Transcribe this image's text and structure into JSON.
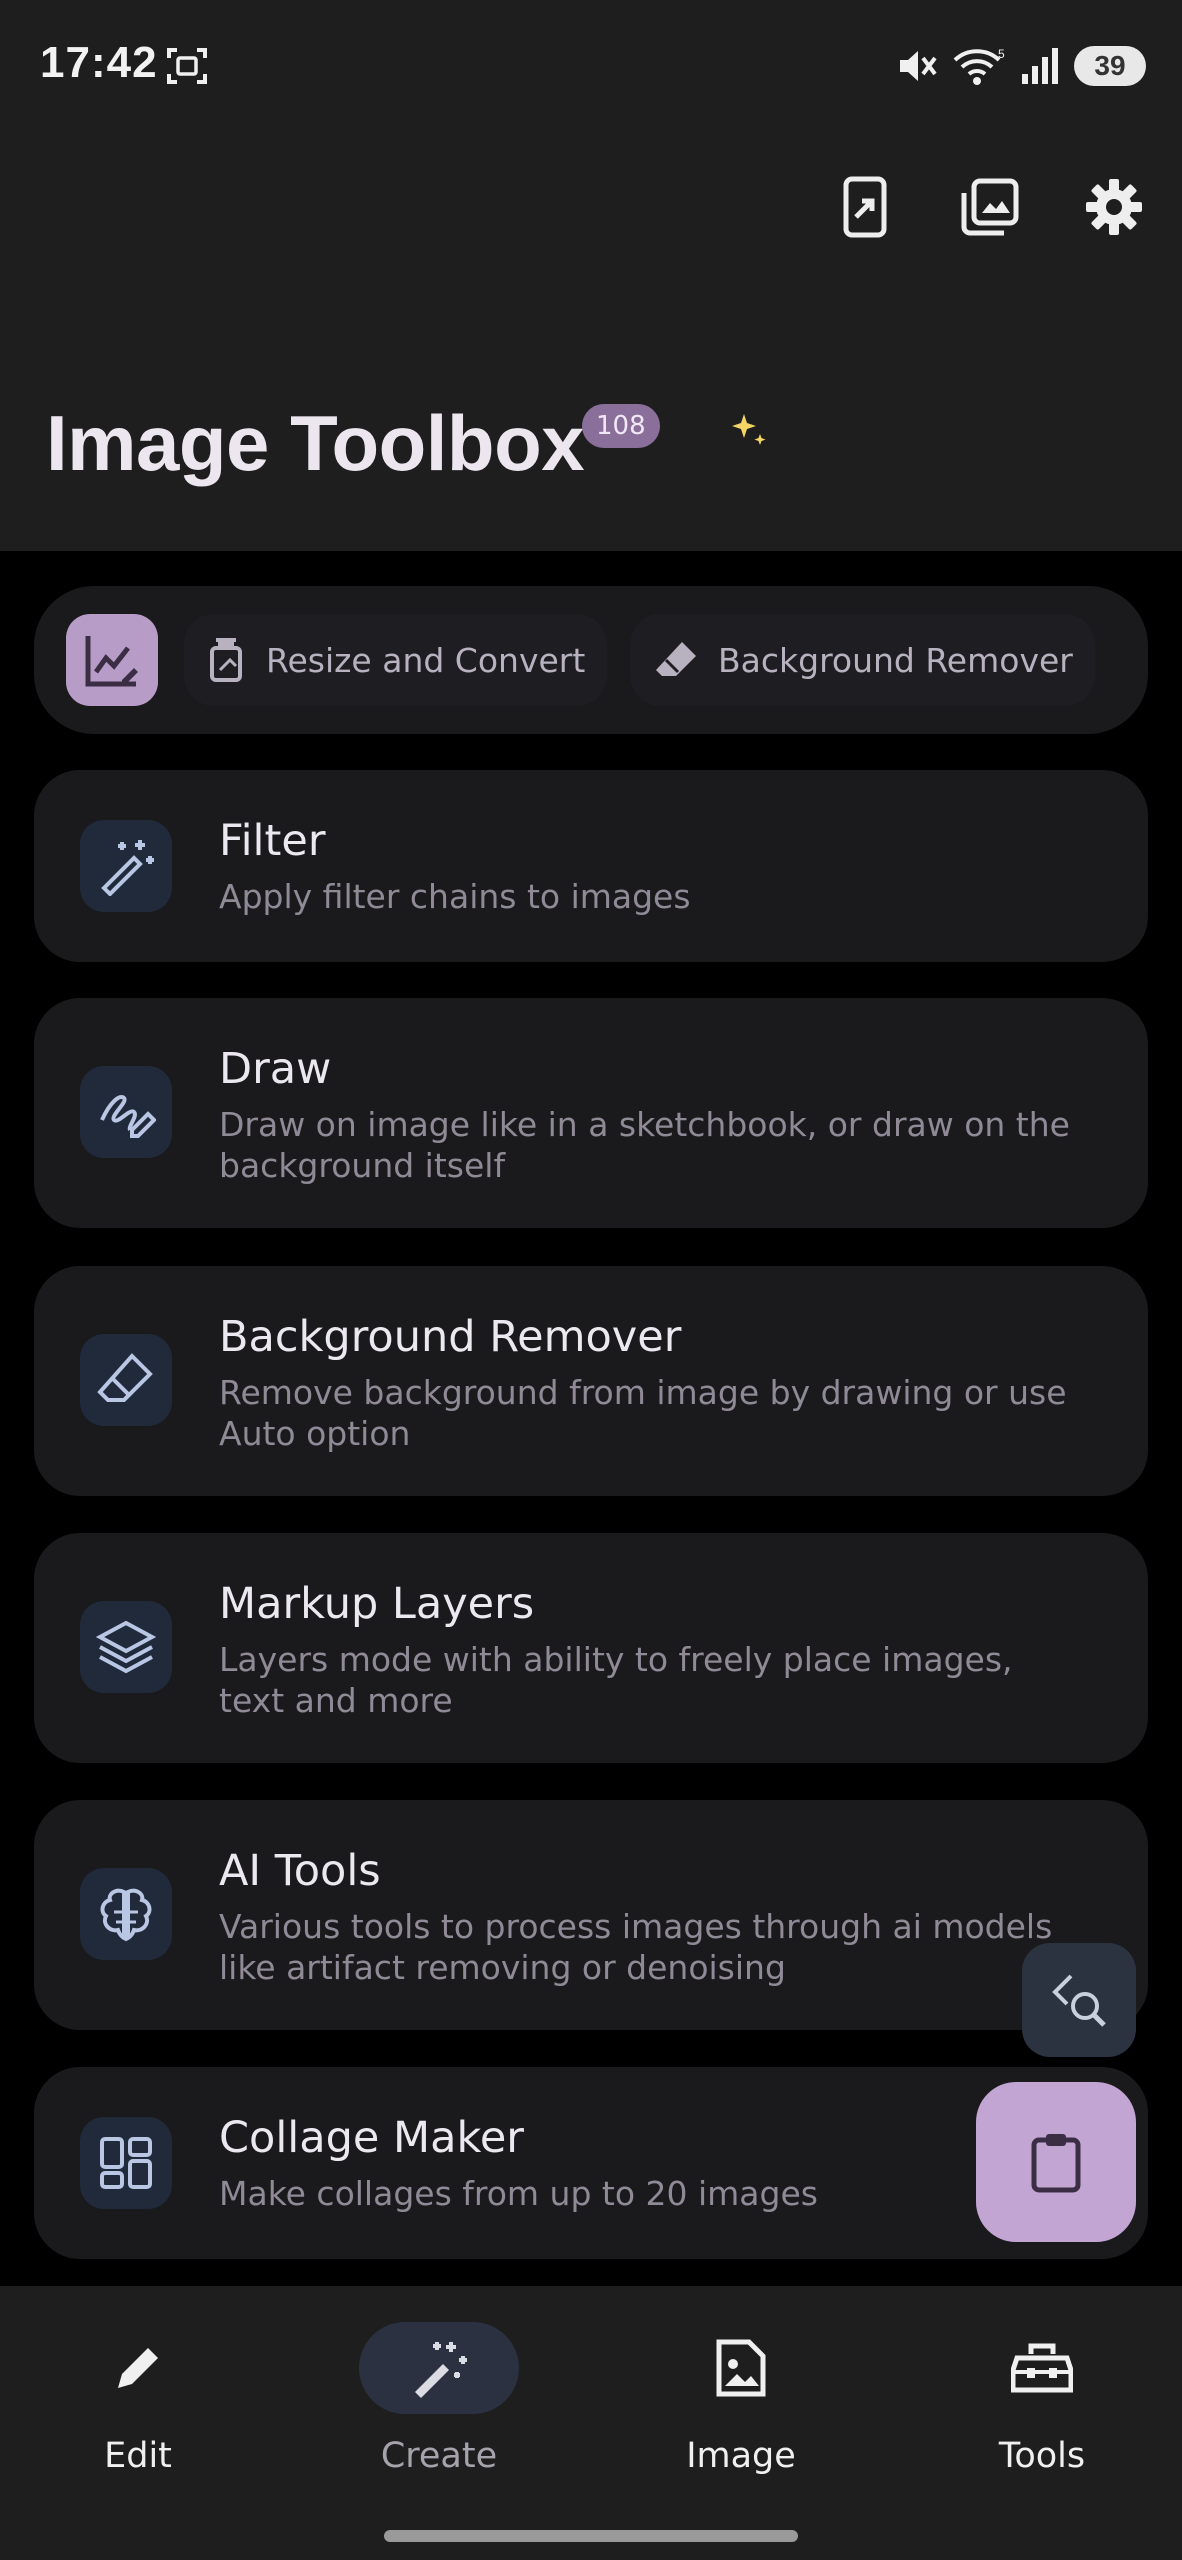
{
  "status_bar": {
    "time": "17:42",
    "battery": "39",
    "icons": [
      "screenshot-icon",
      "mute-icon",
      "wifi-icon",
      "signal-icon"
    ]
  },
  "header": {
    "app_title": "Image Toolbox",
    "version_badge": "108",
    "actions": [
      "share-to-device-icon",
      "gallery-icon",
      "settings-icon"
    ]
  },
  "favorites": {
    "chips": [
      "Resize and Convert",
      "Background Remover"
    ]
  },
  "tools": [
    {
      "title": "Filter",
      "description": "Apply filter chains to images",
      "icon": "magic-wand-icon"
    },
    {
      "title": "Draw",
      "description": "Draw on image like in a sketchbook, or draw on the background itself",
      "icon": "draw-icon"
    },
    {
      "title": "Background Remover",
      "description": "Remove background from image by drawing or use Auto option",
      "icon": "eraser-icon"
    },
    {
      "title": "Markup Layers",
      "description": "Layers mode with ability to freely place images, text and more",
      "icon": "layers-icon"
    },
    {
      "title": "AI Tools",
      "description": "Various tools to process images through ai models like artifact removing or denoising",
      "icon": "brain-icon"
    },
    {
      "title": "Collage Maker",
      "description": "Make collages from up to 20 images",
      "icon": "collage-icon"
    }
  ],
  "bottom_nav": {
    "items": [
      {
        "label": "Edit",
        "icon": "pencil-icon",
        "active": false
      },
      {
        "label": "Create",
        "icon": "magic-wand-icon",
        "active": true
      },
      {
        "label": "Image",
        "icon": "image-file-icon",
        "active": false
      },
      {
        "label": "Tools",
        "icon": "toolbox-icon",
        "active": false
      }
    ]
  },
  "colors": {
    "accent": "#c2a5d2",
    "badge": "#8a6f9a",
    "card": "#1a1a1d",
    "icon_box": "#212a3a"
  }
}
